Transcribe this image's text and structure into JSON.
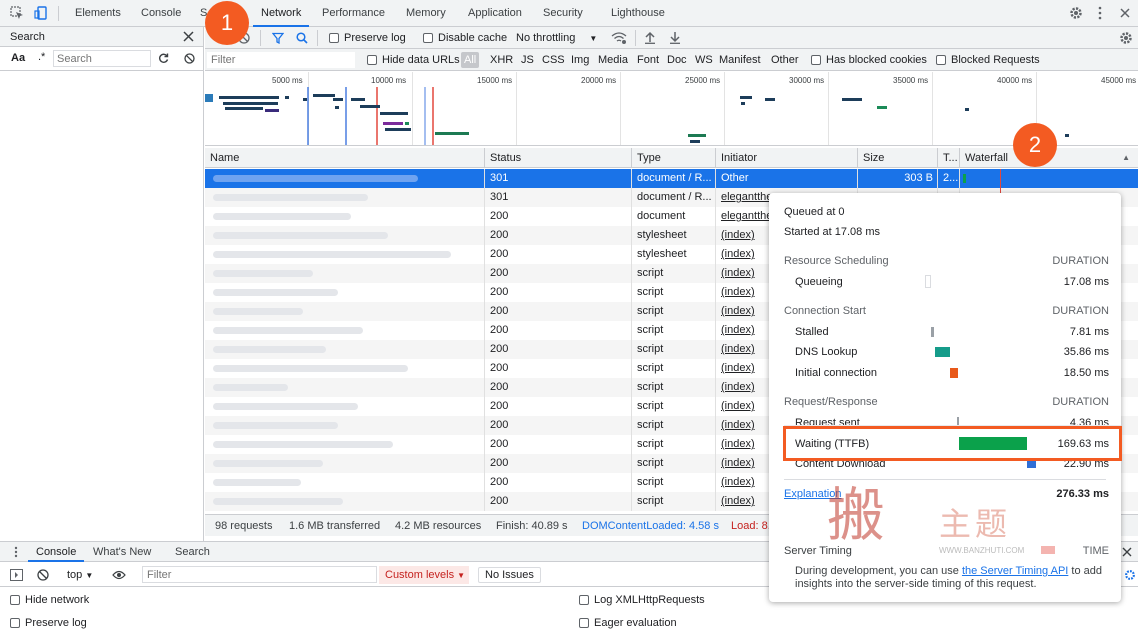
{
  "top_tabs": [
    "Elements",
    "Console",
    "S",
    "Network",
    "Performance",
    "Memory",
    "Application",
    "Security",
    "Lighthouse"
  ],
  "search_pane": {
    "title": "Search",
    "case_label": "Aa",
    "regex_label": ".*",
    "input_placeholder": "Search"
  },
  "network_toolbar": {
    "preserve_log": "Preserve log",
    "disable_cache": "Disable cache",
    "throttling": "No throttling"
  },
  "filter_bar": {
    "filter_placeholder": "Filter",
    "hide_data_urls": "Hide data URLs",
    "types": [
      "All",
      "XHR",
      "JS",
      "CSS",
      "Img",
      "Media",
      "Font",
      "Doc",
      "WS",
      "Manifest",
      "Other"
    ],
    "has_blocked_cookies": "Has blocked cookies",
    "blocked_requests": "Blocked Requests"
  },
  "overview_ticks": [
    "5000 ms",
    "10000 ms",
    "15000 ms",
    "20000 ms",
    "25000 ms",
    "30000 ms",
    "35000 ms",
    "40000 ms",
    "45000 ms"
  ],
  "columns": [
    "Name",
    "Status",
    "Type",
    "Initiator",
    "Size",
    "T...",
    "Waterfall"
  ],
  "rows": [
    {
      "status": "301",
      "type": "document / R...",
      "initiator": "Other",
      "size": "303 B",
      "time": "2...",
      "link": false
    },
    {
      "status": "301",
      "type": "document / R...",
      "initiator": "elegantthe",
      "size": "",
      "time": "",
      "link": true
    },
    {
      "status": "200",
      "type": "document",
      "initiator": "elegantthe",
      "size": "",
      "time": "",
      "link": true
    },
    {
      "status": "200",
      "type": "stylesheet",
      "initiator": "(index)",
      "size": "",
      "time": "",
      "link": true
    },
    {
      "status": "200",
      "type": "stylesheet",
      "initiator": "(index)",
      "size": "",
      "time": "",
      "link": true
    },
    {
      "status": "200",
      "type": "script",
      "initiator": "(index)",
      "size": "",
      "time": "",
      "link": true
    },
    {
      "status": "200",
      "type": "script",
      "initiator": "(index)",
      "size": "",
      "time": "",
      "link": true
    },
    {
      "status": "200",
      "type": "script",
      "initiator": "(index)",
      "size": "",
      "time": "",
      "link": true
    },
    {
      "status": "200",
      "type": "script",
      "initiator": "(index)",
      "size": "",
      "time": "",
      "link": true
    },
    {
      "status": "200",
      "type": "script",
      "initiator": "(index)",
      "size": "",
      "time": "",
      "link": true
    },
    {
      "status": "200",
      "type": "script",
      "initiator": "(index)",
      "size": "",
      "time": "",
      "link": true
    },
    {
      "status": "200",
      "type": "script",
      "initiator": "(index)",
      "size": "",
      "time": "",
      "link": true
    },
    {
      "status": "200",
      "type": "script",
      "initiator": "(index)",
      "size": "",
      "time": "",
      "link": true
    },
    {
      "status": "200",
      "type": "script",
      "initiator": "(index)",
      "size": "",
      "time": "",
      "link": true
    },
    {
      "status": "200",
      "type": "script",
      "initiator": "(index)",
      "size": "",
      "time": "",
      "link": true
    },
    {
      "status": "200",
      "type": "script",
      "initiator": "(index)",
      "size": "",
      "time": "",
      "link": true
    },
    {
      "status": "200",
      "type": "script",
      "initiator": "(index)",
      "size": "",
      "time": "",
      "link": true
    },
    {
      "status": "200",
      "type": "script",
      "initiator": "(index)",
      "size": "",
      "time": "",
      "link": true
    }
  ],
  "status_bar": {
    "requests": "98 requests",
    "transferred": "1.6 MB transferred",
    "resources": "4.2 MB resources",
    "finish": "Finish: 40.89 s",
    "dom_content_loaded": "DOMContentLoaded: 4.58 s",
    "load": "Load: 8."
  },
  "drawer": {
    "tabs": [
      "Console",
      "What's New",
      "Search"
    ],
    "context": "top",
    "filter_placeholder": "Filter",
    "levels": "Custom levels",
    "issues": "No Issues",
    "settings": [
      "Hide network",
      "Log XMLHttpRequests",
      "Preserve log",
      "Eager evaluation"
    ]
  },
  "timing": {
    "queued_at": "Queued at 0",
    "started_at": "Started at 17.08 ms",
    "duration_label": "DURATION",
    "sections": [
      {
        "title": "Resource Scheduling",
        "items": [
          {
            "label": "Queueing",
            "value": "17.08 ms"
          }
        ]
      },
      {
        "title": "Connection Start",
        "items": [
          {
            "label": "Stalled",
            "value": "7.81 ms"
          },
          {
            "label": "DNS Lookup",
            "value": "35.86 ms"
          },
          {
            "label": "Initial connection",
            "value": "18.50 ms"
          }
        ]
      },
      {
        "title": "Request/Response",
        "items": [
          {
            "label": "Request sent",
            "value": "4.36 ms"
          },
          {
            "label": "Waiting (TTFB)",
            "value": "169.63 ms"
          },
          {
            "label": "Content Download",
            "value": "22.90 ms"
          }
        ]
      }
    ],
    "explanation": "Explanation",
    "total": "276.33 ms",
    "server_timing": "Server Timing",
    "time_label": "TIME",
    "server_text_1": "During development, you can use",
    "server_link": "the Server Timing API",
    "server_text_2": "to add",
    "server_text_3": "insights into the server-side timing of this request."
  },
  "watermark": {
    "char": "搬",
    "text": "主题",
    "url": "WWW.BANZHUTI.COM"
  },
  "badges": [
    "1",
    "2"
  ],
  "colors": {
    "accent": "#1a73e8",
    "highlight": "#f35b22",
    "ttfb": "#0ba14b",
    "dns": "#159c8a",
    "connect": "#e8591a",
    "download": "#2f6fd6"
  }
}
